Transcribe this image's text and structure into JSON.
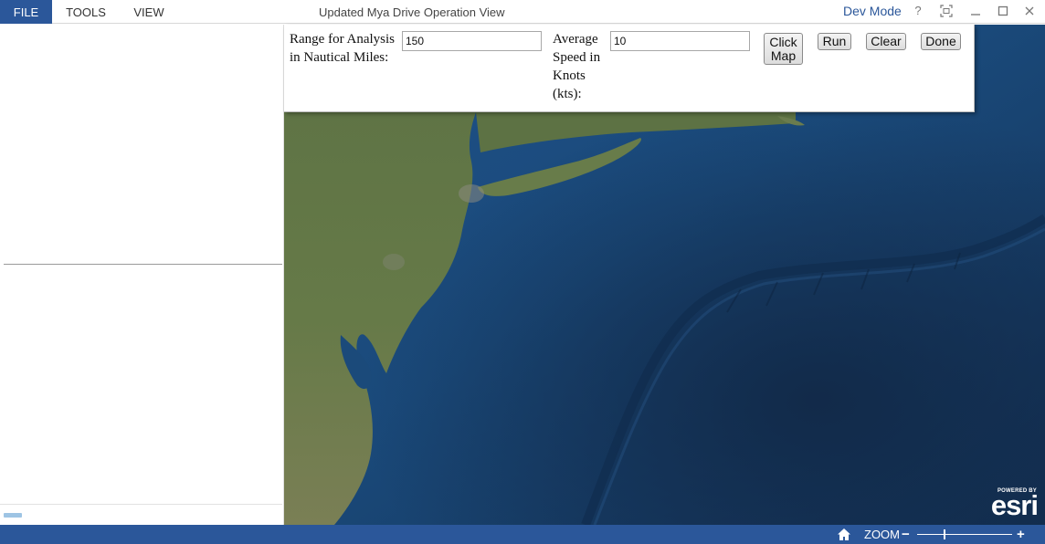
{
  "menu": {
    "file": "FILE",
    "tools": "TOOLS",
    "view": "VIEW"
  },
  "window": {
    "title": "Updated Mya Drive Operation View",
    "dev_mode": "Dev Mode",
    "help_icon": "help-icon",
    "fullscreen_icon": "fullscreen-icon",
    "minimize_icon": "minimize-icon",
    "maximize_icon": "maximize-icon",
    "close_icon": "close-icon"
  },
  "widget": {
    "range_label": "Range for Analysis in Nautical Miles:",
    "range_value": "150",
    "speed_label": "Average Speed in Knots (kts):",
    "speed_value": "10",
    "click_map_button": "Click\nMap",
    "run_button": "Run",
    "clear_button": "Clear",
    "done_button": "Done"
  },
  "map": {
    "basemap": "satellite-imagery",
    "attribution_powered": "POWERED BY",
    "attribution_logo": "esri"
  },
  "statusbar": {
    "home_icon": "home-icon",
    "zoom_label": "ZOOM",
    "zoom_minus": "−",
    "zoom_plus": "+",
    "zoom_level": 0.29
  },
  "colors": {
    "accent": "#2b579a",
    "ocean": "#17406a",
    "land": "#5a6e3f"
  }
}
